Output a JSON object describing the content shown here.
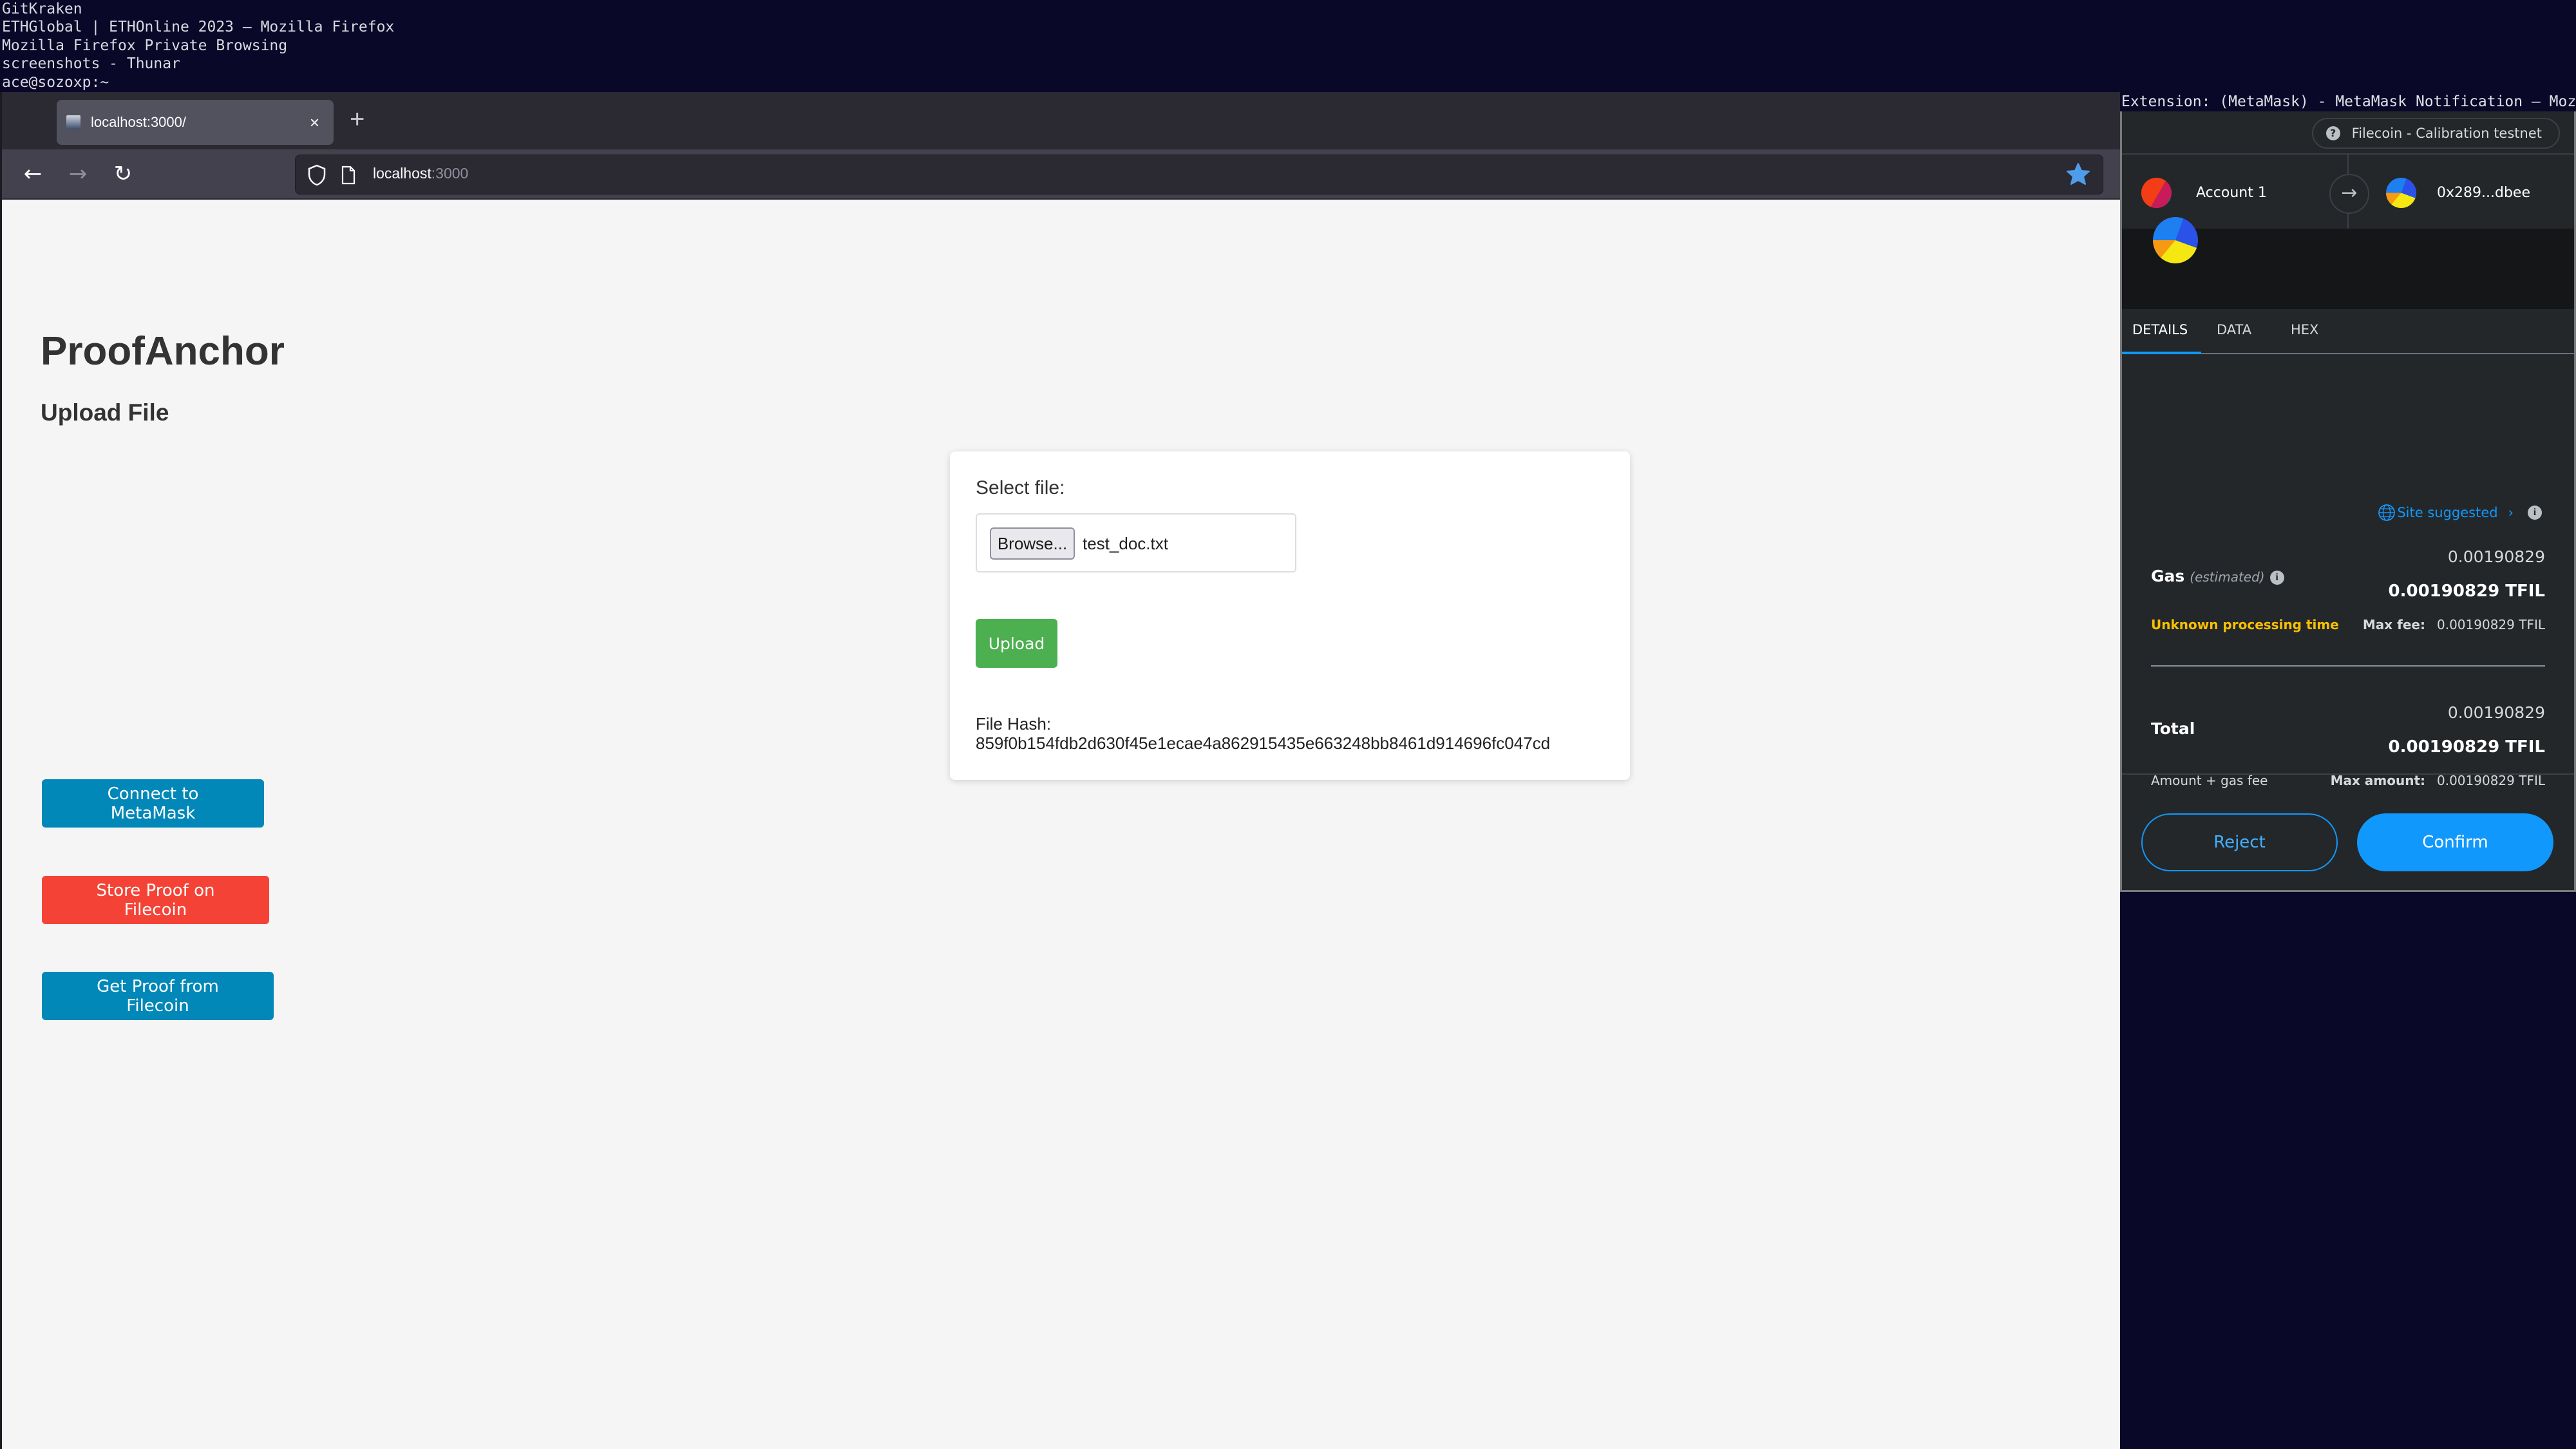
{
  "window_list": [
    "GitKraken",
    "ETHGlobal | ETHOnline 2023 — Mozilla Firefox",
    "Mozilla Firefox Private Browsing",
    "screenshots - Thunar",
    "ace@sozoxp:~"
  ],
  "browser": {
    "tab": {
      "title": "localhost:3000/",
      "close_icon": "×"
    },
    "new_tab_icon": "+",
    "nav": {
      "back": "←",
      "forward": "→",
      "reload": "↻"
    },
    "url_host": "localhost",
    "url_port": ":3000",
    "bookmark_color": "#4f9dea"
  },
  "page": {
    "title": "ProofAnchor",
    "section_title": "Upload File",
    "card": {
      "select_label": "Select file:",
      "browse_label": "Browse...",
      "file_name": "test_doc.txt",
      "upload_label": "Upload",
      "hash_label": "File Hash:",
      "hash_value": "859f0b154fdb2d630f45e1ecae4a862915435e663248bb8461d914696fc047cd"
    },
    "buttons": {
      "connect": "Connect to MetaMask",
      "store": "Store Proof on Filecoin",
      "get": "Get Proof from Filecoin"
    },
    "colors": {
      "primary": "#0288b8",
      "danger": "#f44336",
      "success": "#4caf50"
    }
  },
  "metamask": {
    "window_title": "Extension: (MetaMask) - MetaMask Notification — Mozil…",
    "network": "Filecoin - Calibration testnet",
    "network_icon": "?",
    "from_account": "Account 1",
    "to_address": "0x289...dbee",
    "tabs": [
      "DETAILS",
      "DATA",
      "HEX"
    ],
    "active_tab": "DETAILS",
    "site_suggested": "Site suggested",
    "gas": {
      "label": "Gas",
      "sublabel": "(estimated)",
      "value": "0.00190829",
      "value_token": "0.00190829 TFIL",
      "processing": "Unknown processing time",
      "max_fee_label": "Max fee:",
      "max_fee_value": "0.00190829 TFIL"
    },
    "total": {
      "label": "Total",
      "value": "0.00190829",
      "value_token": "0.00190829 TFIL",
      "note": "Amount + gas fee",
      "max_amount_label": "Max amount:",
      "max_amount_value": "0.00190829 TFIL"
    },
    "reject_label": "Reject",
    "confirm_label": "Confirm",
    "accent": "#1098fc",
    "warning_color": "#f8c000"
  }
}
